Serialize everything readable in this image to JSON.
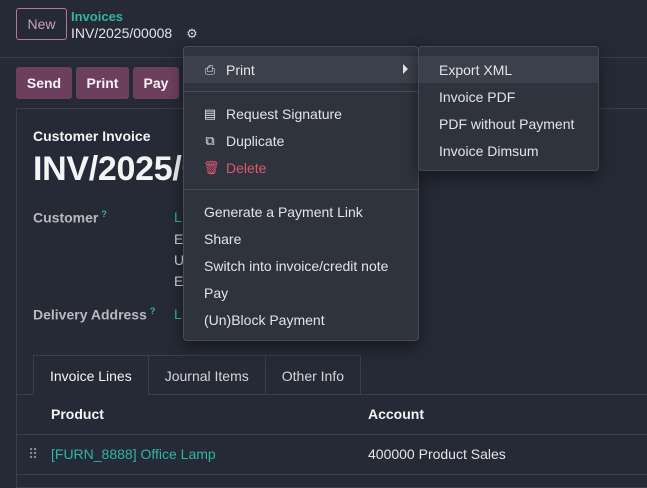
{
  "header": {
    "new_label": "New",
    "breadcrumb": "Invoices",
    "record_name": "INV/2025/00008",
    "gear_icon": "gear-icon"
  },
  "actions": {
    "send": "Send",
    "print": "Print",
    "pay": "Pay"
  },
  "form": {
    "type_label": "Customer Invoice",
    "title": "INV/2025/00008",
    "customer_label": "Customer",
    "customer_help": "?",
    "customer_lines": [
      "L",
      "E",
      "U",
      "E"
    ],
    "delivery_label": "Delivery Address",
    "delivery_help": "?",
    "delivery_value": "L"
  },
  "tabs": [
    "Invoice Lines",
    "Journal Items",
    "Other Info"
  ],
  "table": {
    "columns": [
      "Product",
      "Account"
    ],
    "rows": [
      {
        "product": "[FURN_8888] Office Lamp",
        "account": "400000 Product Sales"
      }
    ]
  },
  "gear_menu": {
    "print": "Print",
    "request_signature": "Request Signature",
    "duplicate": "Duplicate",
    "delete": "Delete",
    "generate_payment_link": "Generate a Payment Link",
    "share": "Share",
    "switch_credit_note": "Switch into invoice/credit note",
    "pay": "Pay",
    "unblock_payment": "(Un)Block Payment"
  },
  "print_submenu": [
    "Export XML",
    "Invoice PDF",
    "PDF without Payment",
    "Invoice Dimsum"
  ],
  "colors": {
    "accent_teal": "#2eb5a4",
    "primary_button": "#6d3f5e",
    "danger": "#e0566a",
    "background": "#262a36"
  }
}
